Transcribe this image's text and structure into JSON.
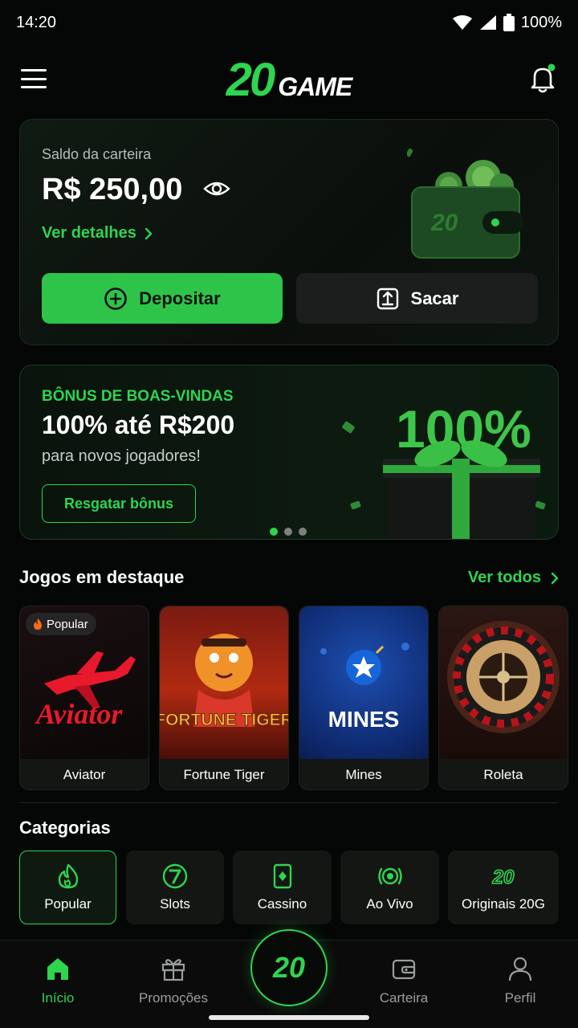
{
  "status_bar": {
    "time": "14:20",
    "battery": "100%"
  },
  "header": {
    "logo_number": "20",
    "logo_word": "GAME"
  },
  "wallet": {
    "label": "Saldo da carteira",
    "balance": "R$ 250,00",
    "details_link": "Ver detalhes",
    "deposit_label": "Depositar",
    "withdraw_label": "Sacar",
    "art_number": "20"
  },
  "banner": {
    "kicker": "BÔNUS DE BOAS-VINDAS",
    "title": "100% até R$200",
    "subtitle": "para novos jogadores!",
    "button_label": "Resgatar bônus",
    "art_text": "100%",
    "slides": 3,
    "active_slide": 1
  },
  "featured": {
    "title": "Jogos em destaque",
    "see_all": "Ver todos",
    "games": [
      {
        "name": "Aviator",
        "badge": "Popular",
        "thumb_text": "Aviator"
      },
      {
        "name": "Fortune Tiger",
        "thumb_text": "FORTUNE TIGER"
      },
      {
        "name": "Mines",
        "thumb_text": "MINES"
      },
      {
        "name": "Roleta"
      }
    ]
  },
  "categories": {
    "title": "Categorias",
    "items": [
      {
        "label": "Popular",
        "icon": "flame-icon",
        "active": true
      },
      {
        "label": "Slots",
        "icon": "slot-seven-icon"
      },
      {
        "label": "Cassino",
        "icon": "card-icon"
      },
      {
        "label": "Ao Vivo",
        "icon": "live-icon"
      },
      {
        "label": "Originais 20G",
        "icon": "twenty-icon",
        "icon_text": "20"
      }
    ]
  },
  "bottom_nav": {
    "items": [
      {
        "label": "Início",
        "active": true
      },
      {
        "label": "Promoções"
      },
      {
        "label": "Carteira"
      },
      {
        "label": "Perfil"
      }
    ],
    "center_label": "20"
  },
  "colors": {
    "accent": "#2fd44f",
    "background": "#050706",
    "card": "#141614"
  }
}
